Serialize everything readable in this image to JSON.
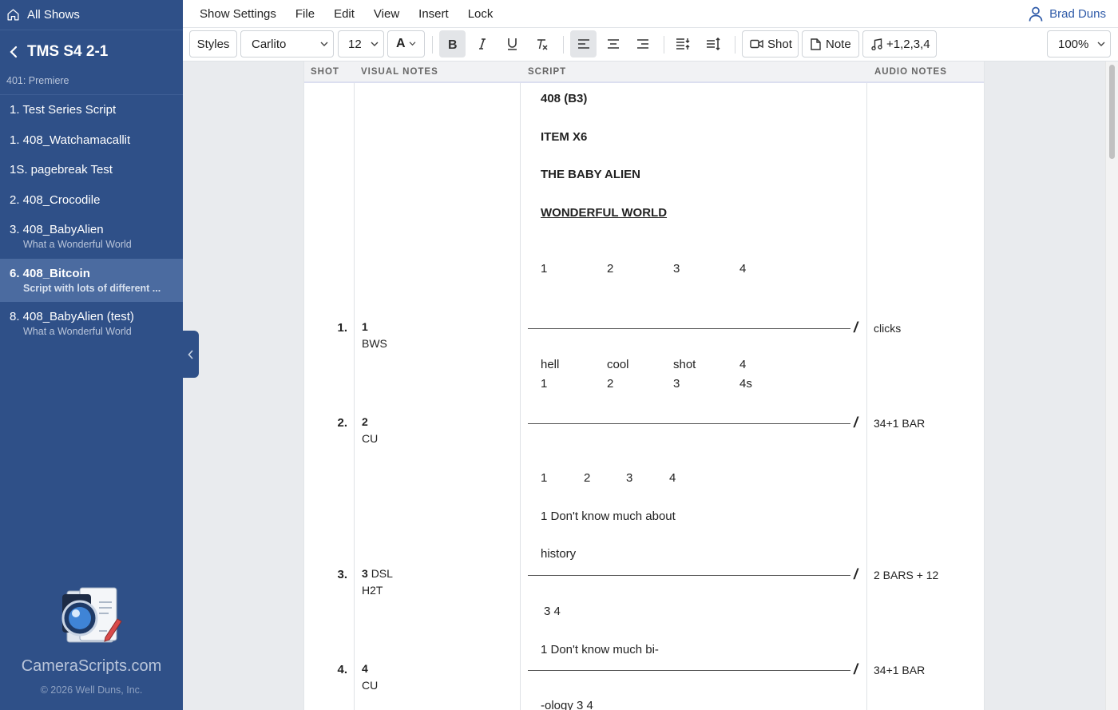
{
  "sidebar": {
    "all_shows": "All Shows",
    "show_title": "TMS S4 2-1",
    "episode": "401: Premiere",
    "items": [
      {
        "label": "1. Test Series Script",
        "sub": ""
      },
      {
        "label": "1. 408_Watchamacallit",
        "sub": ""
      },
      {
        "label": "1S. pagebreak Test",
        "sub": ""
      },
      {
        "label": "2. 408_Crocodile",
        "sub": ""
      },
      {
        "label": "3. 408_BabyAlien",
        "sub": "What a Wonderful World"
      },
      {
        "label": "6. 408_Bitcoin",
        "sub": "Script with lots of different ...",
        "active": true
      },
      {
        "label": "8. 408_BabyAlien (test)",
        "sub": "What a Wonderful World"
      }
    ],
    "brand": "CameraScripts.com",
    "copyright": "© 2026 Well Duns, Inc."
  },
  "menubar": {
    "items": [
      "Show Settings",
      "File",
      "Edit",
      "View",
      "Insert",
      "Lock"
    ],
    "user": "Brad Duns"
  },
  "toolbar": {
    "styles": "Styles",
    "font": "Carlito",
    "size": "12",
    "text_color": "A",
    "shot": "Shot",
    "note": "Note",
    "music": "+1,2,3,4",
    "zoom": "100%"
  },
  "columns": {
    "shot": "SHOT",
    "visual": "VISUAL NOTES",
    "script": "SCRIPT",
    "audio": "AUDIO NOTES"
  },
  "script": {
    "header": [
      "408 (B3)",
      "ITEM X6",
      "THE BABY ALIEN",
      "WONDERFUL WORLD"
    ],
    "count1": [
      "1",
      "2",
      "3",
      "4"
    ],
    "row_a": [
      "hell",
      "cool",
      "shot",
      "4"
    ],
    "row_b": [
      "1",
      "2",
      "3",
      "4s"
    ],
    "count2": [
      "1",
      "2",
      "3",
      "4"
    ],
    "lyric1": "1 Don't know much about",
    "lyric2": "history",
    "lyric3": "3 4",
    "lyric4": "1 Don't know much bi-",
    "lyric5": "-ology 3 4"
  },
  "shots": [
    {
      "num": "1.",
      "id": "1",
      "vn": "BWS",
      "audio": "clicks"
    },
    {
      "num": "2.",
      "id": "2",
      "vn": "CU",
      "audio": "34+1 BAR"
    },
    {
      "num": "3.",
      "id": "3",
      "vn_inline": "DSL",
      "vn": "H2T",
      "audio": "2 BARS + 12"
    },
    {
      "num": "4.",
      "id": "4",
      "vn": "CU",
      "audio": "34+1 BAR"
    }
  ],
  "colors": {
    "sidebar": "#2f5088",
    "sidebar_active": "#4b6ba0",
    "accent": "#2e5aa8"
  }
}
